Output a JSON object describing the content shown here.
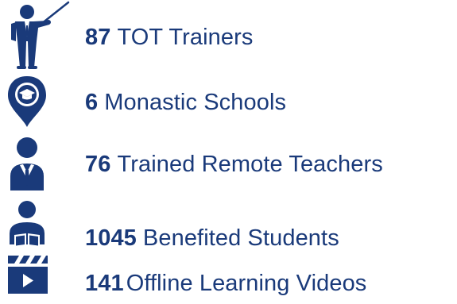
{
  "colors": {
    "primary": "#1a3a7a",
    "white": "#ffffff"
  },
  "stats": [
    {
      "icon": "trainer-icon",
      "number": "87",
      "label": "TOT Trainers"
    },
    {
      "icon": "school-location-icon",
      "number": "6",
      "label": "Monastic Schools"
    },
    {
      "icon": "teacher-icon",
      "number": "76",
      "label": "Trained Remote Teachers"
    },
    {
      "icon": "student-reading-icon",
      "number": "1045",
      "label": "Benefited Students"
    },
    {
      "icon": "video-icon",
      "number": "141",
      "label": "Offline Learning Videos"
    }
  ]
}
